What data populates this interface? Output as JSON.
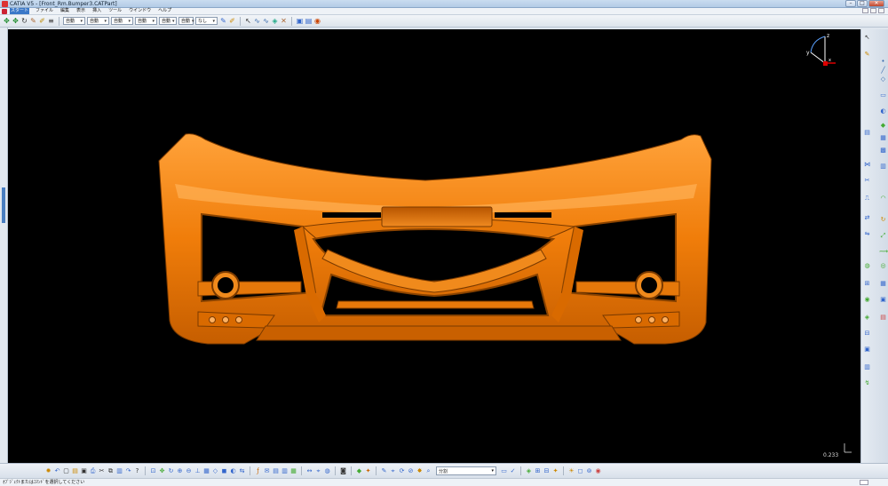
{
  "window": {
    "title": "CATIA V5 - [Front_Rm.Bumper3.CATPart]",
    "minimize": "–",
    "maximize": "□",
    "close": "✕"
  },
  "menu": {
    "items": [
      "スタート",
      "ファイル",
      "編集",
      "表示",
      "挿入",
      "ツール",
      "ウインドウ",
      "ヘルプ"
    ],
    "active_index": 0
  },
  "toolbar_top": {
    "combos": [
      {
        "value": "自動"
      },
      {
        "value": "自動"
      },
      {
        "value": "自動"
      },
      {
        "value": "自動"
      },
      {
        "value": "自動"
      },
      {
        "value": "自動"
      },
      {
        "value": "なし"
      }
    ]
  },
  "viewport": {
    "background": "#000000",
    "model_color": "#f07d0a",
    "compass_axes": {
      "z": "z",
      "x": "x",
      "y": "y"
    },
    "scale_value": "0.233"
  },
  "toolbar_bottom": {
    "search_value": "分割"
  },
  "status": {
    "message": "ｵﾌﾞｼﾞｪｸﾄまたはｺﾏﾝﾄﾞを選択してください"
  }
}
